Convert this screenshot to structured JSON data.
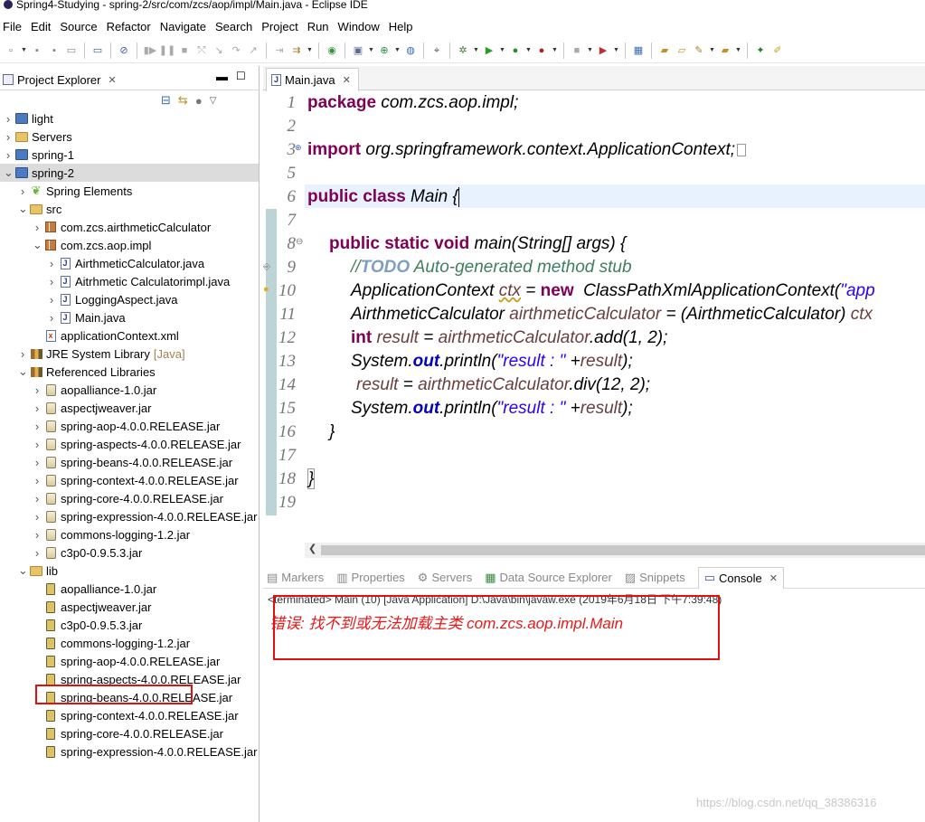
{
  "window": {
    "title": "Spring4-Studying - spring-2/src/com/zcs/aop/impl/Main.java - Eclipse IDE"
  },
  "menu": [
    "File",
    "Edit",
    "Source",
    "Refactor",
    "Navigate",
    "Search",
    "Project",
    "Run",
    "Window",
    "Help"
  ],
  "project_explorer": {
    "title": "Project Explorer",
    "tree": [
      {
        "label": "light",
        "depth": 0,
        "icon": "project-icon"
      },
      {
        "label": "Servers",
        "depth": 0,
        "icon": "folder-icon"
      },
      {
        "label": "spring-1",
        "depth": 0,
        "icon": "project-icon"
      },
      {
        "label": "spring-2",
        "depth": 0,
        "icon": "project-icon",
        "selected": true
      },
      {
        "label": "Spring Elements",
        "depth": 1,
        "icon": "spring-leaf-icon"
      },
      {
        "label": "src",
        "depth": 1,
        "icon": "source-folder-icon"
      },
      {
        "label": "com.zcs.airthmeticCalculator",
        "depth": 2,
        "icon": "package-icon"
      },
      {
        "label": "com.zcs.aop.impl",
        "depth": 2,
        "icon": "package-icon"
      },
      {
        "label": "AirthmeticCalculator.java",
        "depth": 3,
        "icon": "java-file-icon"
      },
      {
        "label": "Aitrhmetic Calculatorimpl.java",
        "depth": 3,
        "icon": "java-file-icon"
      },
      {
        "label": "LoggingAspect.java",
        "depth": 3,
        "icon": "java-file-icon"
      },
      {
        "label": "Main.java",
        "depth": 3,
        "icon": "java-file-icon"
      },
      {
        "label": "applicationContext.xml",
        "depth": 2,
        "icon": "xml-file-icon"
      },
      {
        "label": "JRE System Library",
        "suffix": "[Java]",
        "depth": 1,
        "icon": "library-icon"
      },
      {
        "label": "Referenced Libraries",
        "depth": 1,
        "icon": "library-icon"
      },
      {
        "label": "aopalliance-1.0.jar",
        "depth": 2,
        "icon": "jar-icon"
      },
      {
        "label": "aspectjweaver.jar",
        "depth": 2,
        "icon": "jar-icon"
      },
      {
        "label": "spring-aop-4.0.0.RELEASE.jar",
        "depth": 2,
        "icon": "jar-icon"
      },
      {
        "label": "spring-aspects-4.0.0.RELEASE.jar",
        "depth": 2,
        "icon": "jar-icon"
      },
      {
        "label": "spring-beans-4.0.0.RELEASE.jar",
        "depth": 2,
        "icon": "jar-icon"
      },
      {
        "label": "spring-context-4.0.0.RELEASE.jar",
        "depth": 2,
        "icon": "jar-icon"
      },
      {
        "label": "spring-core-4.0.0.RELEASE.jar",
        "depth": 2,
        "icon": "jar-icon"
      },
      {
        "label": "spring-expression-4.0.0.RELEASE.jar",
        "depth": 2,
        "icon": "jar-icon"
      },
      {
        "label": "commons-logging-1.2.jar",
        "depth": 2,
        "icon": "jar-icon"
      },
      {
        "label": "c3p0-0.9.5.3.jar",
        "depth": 2,
        "icon": "jar-icon"
      },
      {
        "label": "lib",
        "depth": 1,
        "icon": "folder-icon"
      },
      {
        "label": "aopalliance-1.0.jar",
        "depth": 2,
        "icon": "jar-file-icon"
      },
      {
        "label": "aspectjweaver.jar",
        "depth": 2,
        "icon": "jar-file-icon"
      },
      {
        "label": "c3p0-0.9.5.3.jar",
        "depth": 2,
        "icon": "jar-file-icon",
        "highlighted": true
      },
      {
        "label": "commons-logging-1.2.jar",
        "depth": 2,
        "icon": "jar-file-icon"
      },
      {
        "label": "spring-aop-4.0.0.RELEASE.jar",
        "depth": 2,
        "icon": "jar-file-icon"
      },
      {
        "label": "spring-aspects-4.0.0.RELEASE.jar",
        "depth": 2,
        "icon": "jar-file-icon"
      },
      {
        "label": "spring-beans-4.0.0.RELEASE.jar",
        "depth": 2,
        "icon": "jar-file-icon"
      },
      {
        "label": "spring-context-4.0.0.RELEASE.jar",
        "depth": 2,
        "icon": "jar-file-icon"
      },
      {
        "label": "spring-core-4.0.0.RELEASE.jar",
        "depth": 2,
        "icon": "jar-file-icon"
      },
      {
        "label": "spring-expression-4.0.0.RELEASE.jar",
        "depth": 2,
        "icon": "jar-file-icon"
      }
    ]
  },
  "editor": {
    "tab": "Main.java",
    "line_numbers": [
      "1",
      "2",
      "3",
      "5",
      "6",
      "7",
      "8",
      "9",
      "10",
      "11",
      "12",
      "13",
      "14",
      "15",
      "16",
      "17",
      "18",
      "19"
    ]
  },
  "code": {
    "l1_kw": "package",
    "l1_rest": " com.zcs.aop.impl;",
    "l3_kw": "import",
    "l3_rest": " org.springframework.context.ApplicationContext;",
    "l5_kw": "public class",
    "l5_rest": " Main {",
    "l7_kw": "public static void",
    "l7_rest": " main(String[] args) {",
    "l8_a": "//",
    "l8_todo": "TODO",
    "l8_b": " Auto-generated method stub",
    "l9_a": "ApplicationContext ",
    "l9_var": "ctx",
    "l9_b": " = ",
    "l9_kw": "new",
    "l9_c": "  ClassPathXmlApplicationContext(",
    "l9_str": "\"app",
    "l10_a": "AirthmeticCalculator ",
    "l10_var": "airthmeticCalculator",
    "l10_b": " = (AirthmeticCalculator) ",
    "l10_var2": "ctx",
    "l11_kw": "int",
    "l11_sp": " ",
    "l11_var": "result",
    "l11_b": " = ",
    "l11_var2": "airthmeticCalculator",
    "l11_c": ".add(1, 2);",
    "l12_a": "System.",
    "l12_fld": "out",
    "l12_b": ".println(",
    "l12_str": "\"result : \"",
    "l12_c": " +",
    "l12_var": "result",
    "l12_d": ");",
    "l13_var": "result",
    "l13_b": " = ",
    "l13_var2": "airthmeticCalculator",
    "l13_c": ".div(12, 2);",
    "l14_a": "System.",
    "l14_fld": "out",
    "l14_b": ".println(",
    "l14_str": "\"result : \"",
    "l14_c": " +",
    "l14_var": "result",
    "l14_d": ");",
    "l15": "}",
    "l17": "}"
  },
  "console": {
    "tabs": [
      "Markers",
      "Properties",
      "Servers",
      "Data Source Explorer",
      "Snippets",
      "Console"
    ],
    "status": "<terminated> Main (10) [Java Application] D:\\Java\\bin\\javaw.exe (2019年6月18日 下午7:39:48)",
    "error": "错误: 找不到或无法加载主类 com.zcs.aop.impl.Main"
  },
  "watermark": "https://blog.csdn.net/qq_38386316",
  "colors": {
    "keyword": "#7f0055",
    "comment": "#3f7f5f",
    "string": "#2a00ff",
    "field": "#0000c0",
    "error": "#e81818",
    "highlight_box": "#e01010"
  }
}
